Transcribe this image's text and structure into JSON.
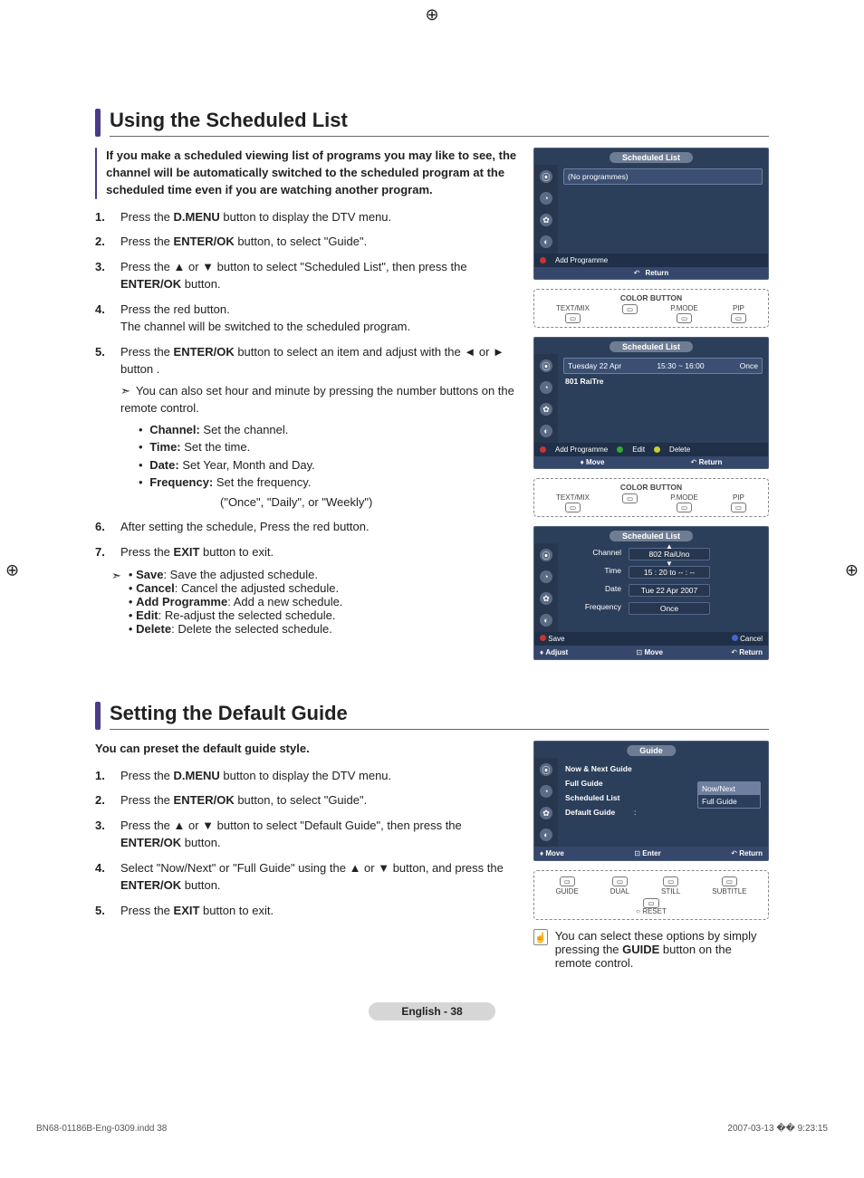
{
  "section1": {
    "title": "Using the Scheduled List",
    "intro": "If you make a scheduled viewing list of programs you may like to see, the channel will be automatically switched to the scheduled program at the scheduled time even if you are watching another program.",
    "steps": {
      "s1_pre": "Press the ",
      "s1_b": "D.MENU",
      "s1_post": " button to display the DTV menu.",
      "s2_pre": "Press the ",
      "s2_b": "ENTER/OK",
      "s2_post": " button, to select \"Guide\".",
      "s3_pre": "Press the ▲ or ▼ button to select \"Scheduled List\", then press the ",
      "s3_b": "ENTER/OK",
      "s3_post": " button.",
      "s4_a": "Press the red button.",
      "s4_b": "The channel will be switched to the scheduled program.",
      "s5_pre": "Press the ",
      "s5_b": "ENTER/OK",
      "s5_post": " button to select an item and adjust with the ◄ or ► button .",
      "s5_note": "You can also set hour and minute by pressing the number buttons on the remote control.",
      "b_channel_l": "Channel:",
      "b_channel_t": " Set the channel.",
      "b_time_l": "Time:",
      "b_time_t": " Set the time.",
      "b_date_l": "Date:",
      "b_date_t": " Set Year, Month and Day.",
      "b_freq_l": "Frequency:",
      "b_freq_t": " Set the frequency.",
      "freq_opts": "(\"Once\", \"Daily\", or \"Weekly\")",
      "s6": "After setting the schedule, Press the red button.",
      "s7_pre": "Press the ",
      "s7_b": "EXIT",
      "s7_post": " button to exit.",
      "tail_save_l": "Save",
      "tail_save_t": ": Save the adjusted schedule.",
      "tail_cancel_l": "Cancel",
      "tail_cancel_t": ": Cancel the adjusted schedule.",
      "tail_add_l": "Add Programme",
      "tail_add_t": ": Add a new schedule.",
      "tail_edit_l": "Edit",
      "tail_edit_t": ": Re-adjust the selected schedule.",
      "tail_delete_l": "Delete",
      "tail_delete_t": ": Delete the selected schedule."
    },
    "osd1": {
      "title": "Scheduled List",
      "noprog": "(No programmes)",
      "add": "Add Programme",
      "return": "Return"
    },
    "remote_hint1": {
      "title": "COLOR BUTTON",
      "b1": "TEXT/MIX",
      "b2": "P.MODE",
      "b3": "PIP"
    },
    "osd2": {
      "title": "Scheduled List",
      "date": "Tuesday  22  Apr",
      "time": "15:30 ~ 16:00",
      "once": "Once",
      "chan": "801  RaiTre",
      "add": "Add Programme",
      "edit": "Edit",
      "delete": "Delete",
      "move": "Move",
      "return": "Return"
    },
    "osd3": {
      "title": "Scheduled List",
      "row_channel_l": "Channel",
      "row_channel_v": "802 RaiUno",
      "row_time_l": "Time",
      "row_time_v": "15 : 20 to -- : --",
      "row_date_l": "Date",
      "row_date_v": "Tue 22 Apr 2007",
      "row_freq_l": "Frequency",
      "row_freq_v": "Once",
      "save": "Save",
      "cancel": "Cancel",
      "adjust": "Adjust",
      "move": "Move",
      "return": "Return"
    }
  },
  "section2": {
    "title": "Setting the Default Guide",
    "intro": "You can preset the default guide style.",
    "steps": {
      "s1_pre": "Press the ",
      "s1_b": "D.MENU",
      "s1_post": " button to display the DTV menu.",
      "s2_pre": "Press the ",
      "s2_b": "ENTER/OK",
      "s2_post": " button, to select \"Guide\".",
      "s3_pre": "Press the ▲ or ▼ button to select \"Default Guide\", then press the ",
      "s3_b": "ENTER/OK",
      "s3_post": " button.",
      "s4_pre": "Select \"Now/Next\" or \"Full Guide\" using the ▲ or ▼ button, and press the ",
      "s4_b": "ENTER/OK",
      "s4_post": " button.",
      "s5_pre": "Press the ",
      "s5_b": "EXIT",
      "s5_post": " button to exit."
    },
    "osd": {
      "title": "Guide",
      "items": {
        "i1": "Now & Next Guide",
        "i2": "Full Guide",
        "i3": "Scheduled List",
        "i4": "Default Guide",
        "colon": ":"
      },
      "popup": {
        "o1": "Now/Next",
        "o2": "Full Guide"
      },
      "move": "Move",
      "enter": "Enter",
      "return": "Return"
    },
    "remote_hint": {
      "b1": "GUIDE",
      "b2": "DUAL",
      "b3": "STILL",
      "b4": "SUBTITLE",
      "reset": "RESET"
    },
    "tip_pre": "You can select these options by simply pressing the ",
    "tip_b": "GUIDE",
    "tip_post": " button on the remote control."
  },
  "page_footer": "English - 38",
  "doc_footer_left": "BN68-01186B-Eng-0309.indd   38",
  "doc_footer_right": "2007-03-13   �� 9:23:15"
}
